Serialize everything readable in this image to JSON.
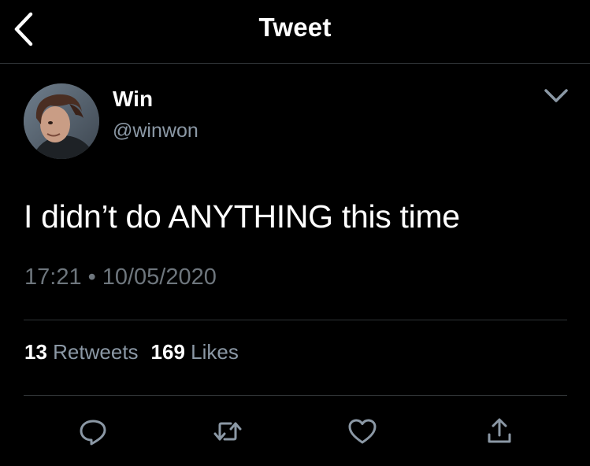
{
  "header": {
    "title": "Tweet",
    "back_icon": "chevron-left-icon"
  },
  "tweet": {
    "author": {
      "display_name": "Win",
      "handle": "@winwon"
    },
    "more_icon": "chevron-down-icon",
    "text": "I didn’t do ANYTHING this time",
    "time": "17:21",
    "separator": "•",
    "date": "10/05/2020"
  },
  "stats": {
    "retweets_count": "13",
    "retweets_label": "Retweets",
    "likes_count": "169",
    "likes_label": "Likes"
  },
  "actions": [
    {
      "icon": "reply-icon"
    },
    {
      "icon": "retweet-icon"
    },
    {
      "icon": "heart-icon"
    },
    {
      "icon": "share-icon"
    }
  ],
  "colors": {
    "background": "#000000",
    "primary_text": "#ffffff",
    "secondary_text": "#8b98a5",
    "divider": "#2f3336"
  }
}
